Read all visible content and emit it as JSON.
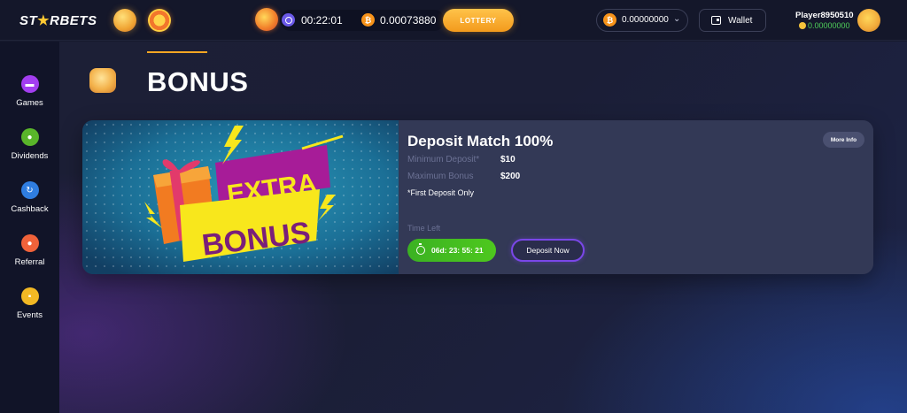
{
  "brand": {
    "logo_prefix": "ST",
    "logo_star": "★",
    "logo_suffix": "RBETS"
  },
  "topbar": {
    "timer": "00:22:01",
    "pot": "0.00073880",
    "lottery_label": "LOTTERY",
    "balance": "0.00000000",
    "chevron": "⌄",
    "wallet_label": "Wallet",
    "username": "Player8950510",
    "user_balance": "0.00000000"
  },
  "sidebar": {
    "items": [
      {
        "label": "Games",
        "icon": "gamepad-icon",
        "color": "#a33ef0"
      },
      {
        "label": "Dividends",
        "icon": "dividends-icon",
        "color": "#59b52a"
      },
      {
        "label": "Cashback",
        "icon": "cashback-icon",
        "color": "#2f7de0"
      },
      {
        "label": "Referral",
        "icon": "referral-icon",
        "color": "#f0623a"
      },
      {
        "label": "Events",
        "icon": "events-icon",
        "color": "#f2b824"
      }
    ]
  },
  "page": {
    "title": "BONUS"
  },
  "bonus": {
    "banner_line1": "EXTRA",
    "banner_line2": "BONUS",
    "title": "Deposit Match 100%",
    "more_info": "More Info",
    "min_deposit_label": "Minimum Deposit*",
    "min_deposit_value": "$10",
    "max_bonus_label": "Maximum Bonus",
    "max_bonus_value": "$200",
    "note": "*First Deposit Only",
    "time_left_label": "Time Left",
    "countdown": "06d: 23: 55: 21",
    "deposit_button": "Deposit Now"
  },
  "colors": {
    "accent": "#f5a623",
    "positive": "#4fd15a",
    "button_border": "#7a47e8"
  }
}
